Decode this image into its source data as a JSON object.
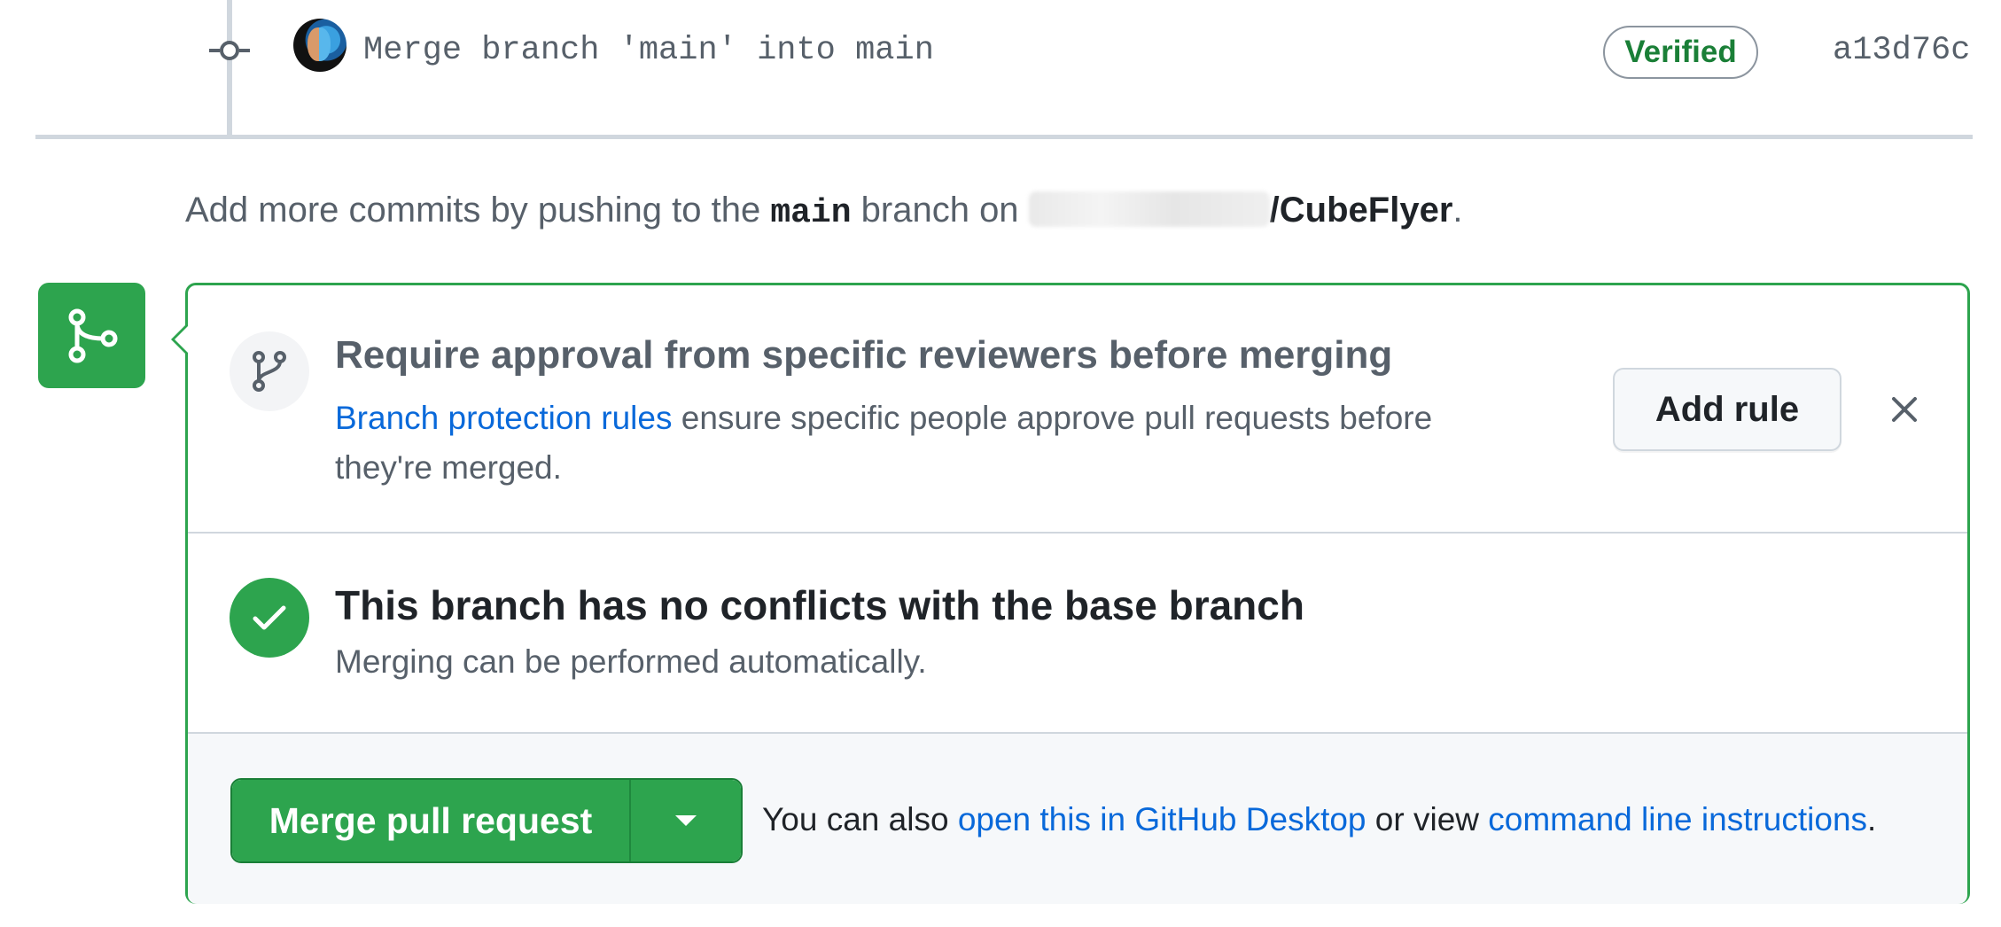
{
  "commit": {
    "message": "Merge branch 'main' into main",
    "verified_label": "Verified",
    "sha": "a13d76c"
  },
  "push_hint": {
    "prefix": "Add more commits by pushing to the ",
    "branch": "main",
    "middle": " branch on ",
    "repo": "/CubeFlyer",
    "suffix": "."
  },
  "rule_prompt": {
    "title": "Require approval from specific reviewers before merging",
    "link_text": "Branch protection rules",
    "desc_rest": " ensure specific people approve pull requests before they're merged.",
    "add_rule_label": "Add rule"
  },
  "conflicts": {
    "title": "This branch has no conflicts with the base branch",
    "subtitle": "Merging can be performed automatically."
  },
  "merge": {
    "button_label": "Merge pull request",
    "also_prefix": "You can also ",
    "desktop_link": "open this in GitHub Desktop",
    "or_view": " or view ",
    "cli_link": "command line instructions",
    "end": "."
  },
  "colors": {
    "success": "#2da44e",
    "link": "#0969da",
    "muted": "#57606a"
  }
}
